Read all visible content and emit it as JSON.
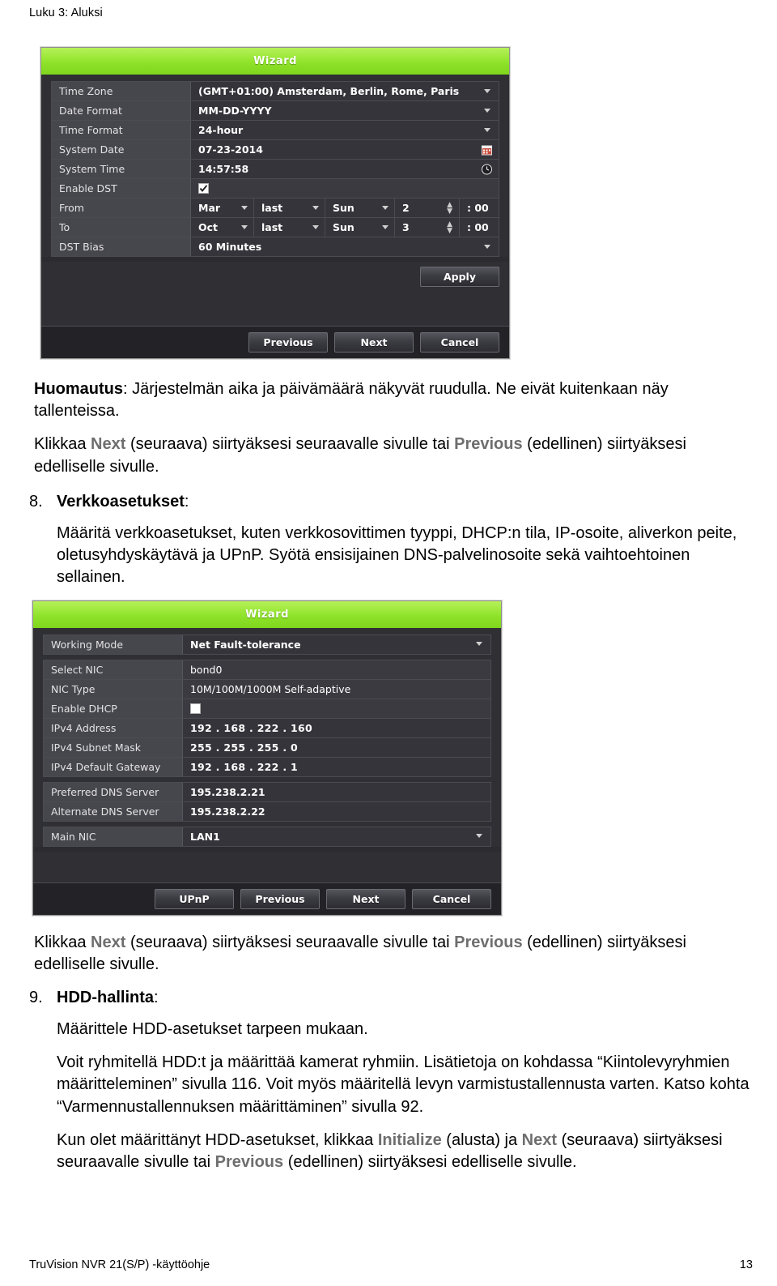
{
  "page": {
    "running_head": "Luku 3: Aluksi",
    "footer_left": "TruVision NVR 21(S/P) -käyttöohje",
    "footer_page": "13"
  },
  "wizard_datetime": {
    "title": "Wizard",
    "rows": [
      {
        "label": "Time Zone",
        "value": "(GMT+01:00) Amsterdam, Berlin, Rome, Paris",
        "control": "dropdown"
      },
      {
        "label": "Date Format",
        "value": "MM-DD-YYYY",
        "control": "dropdown"
      },
      {
        "label": "Time Format",
        "value": "24-hour",
        "control": "dropdown"
      },
      {
        "label": "System Date",
        "value": "07-23-2014",
        "control": "calendar-icon"
      },
      {
        "label": "System Time",
        "value": "14:57:58",
        "control": "clock-icon"
      },
      {
        "label": "Enable DST",
        "value": "",
        "control": "checkbox-checked"
      }
    ],
    "dst_from": {
      "label": "From",
      "month": "Mar",
      "week": "last",
      "weekday": "Sun",
      "hour": "2",
      "minute": ": 00"
    },
    "dst_to": {
      "label": "To",
      "month": "Oct",
      "week": "last",
      "weekday": "Sun",
      "hour": "3",
      "minute": ": 00"
    },
    "dst_bias": {
      "label": "DST Bias",
      "value": "60 Minutes"
    },
    "apply_label": "Apply",
    "buttons": [
      "Previous",
      "Next",
      "Cancel"
    ]
  },
  "wizard_network": {
    "title": "Wizard",
    "working_mode": {
      "label": "Working Mode",
      "value": "Net Fault-tolerance"
    },
    "rows": [
      {
        "label": "Select NIC",
        "value": "bond0"
      },
      {
        "label": "NIC Type",
        "value": "10M/100M/1000M Self-adaptive"
      },
      {
        "label": "Enable DHCP",
        "value": "",
        "control": "checkbox-unchecked"
      },
      {
        "label": "IPv4 Address",
        "value": "192 . 168 . 222 . 160"
      },
      {
        "label": "IPv4 Subnet Mask",
        "value": "255 . 255 . 255 . 0"
      },
      {
        "label": "IPv4 Default Gateway",
        "value": "192 . 168 . 222 . 1"
      }
    ],
    "dns_rows": [
      {
        "label": "Preferred DNS Server",
        "value": "195.238.2.21"
      },
      {
        "label": "Alternate DNS Server",
        "value": "195.238.2.22"
      }
    ],
    "main_nic": {
      "label": "Main NIC",
      "value": "LAN1"
    },
    "buttons": [
      "UPnP",
      "Previous",
      "Next",
      "Cancel"
    ]
  },
  "text": {
    "note_label": "Huomautus",
    "note_body": ": Järjestelmän aika ja päivämäärä näkyvät ruudulla. Ne eivät kuitenkaan näy tallenteissa.",
    "nav_1_a": "Klikkaa ",
    "nav_1_next": "Next",
    "nav_1_b": " (seuraava) siirtyäksesi seuraavalle sivulle tai ",
    "nav_1_prev": "Previous",
    "nav_1_c": " (edellinen) siirtyäksesi edelliselle sivulle.",
    "item8_num": "8.",
    "item8_head": "Verkkoasetukset",
    "item8_colon": ":",
    "item8_body": "Määritä verkkoasetukset, kuten verkkosovittimen tyyppi, DHCP:n tila, IP-osoite, aliverkon peite, oletusyhdyskäytävä ja UPnP. Syötä ensisijainen DNS-palvelinosoite sekä vaihtoehtoinen sellainen.",
    "nav_2_a": "Klikkaa ",
    "nav_2_next": "Next",
    "nav_2_b": " (seuraava) siirtyäksesi seuraavalle sivulle tai ",
    "nav_2_prev": "Previous",
    "nav_2_c": " (edellinen) siirtyäksesi edelliselle sivulle.",
    "item9_num": "9.",
    "item9_head": "HDD-hallinta",
    "item9_colon": ":",
    "item9_body1": "Määrittele HDD-asetukset tarpeen mukaan.",
    "item9_body2": "Voit ryhmitellä HDD:t ja määrittää kamerat ryhmiin. Lisätietoja on kohdassa “Kiintolevyryhmien määritteleminen” sivulla 116. Voit myös määritellä levyn varmistustallennusta varten. Katso kohta “Varmennustallennuksen määrittäminen” sivulla 92.",
    "final_a": "Kun olet määrittänyt HDD-asetukset, klikkaa ",
    "final_init": "Initialize",
    "final_b": " (alusta) ja ",
    "final_next": "Next",
    "final_c": " (seuraava) siirtyäksesi seuraavalle sivulle tai ",
    "final_prev": "Previous",
    "final_d": " (edellinen) siirtyäksesi edelliselle sivulle."
  }
}
